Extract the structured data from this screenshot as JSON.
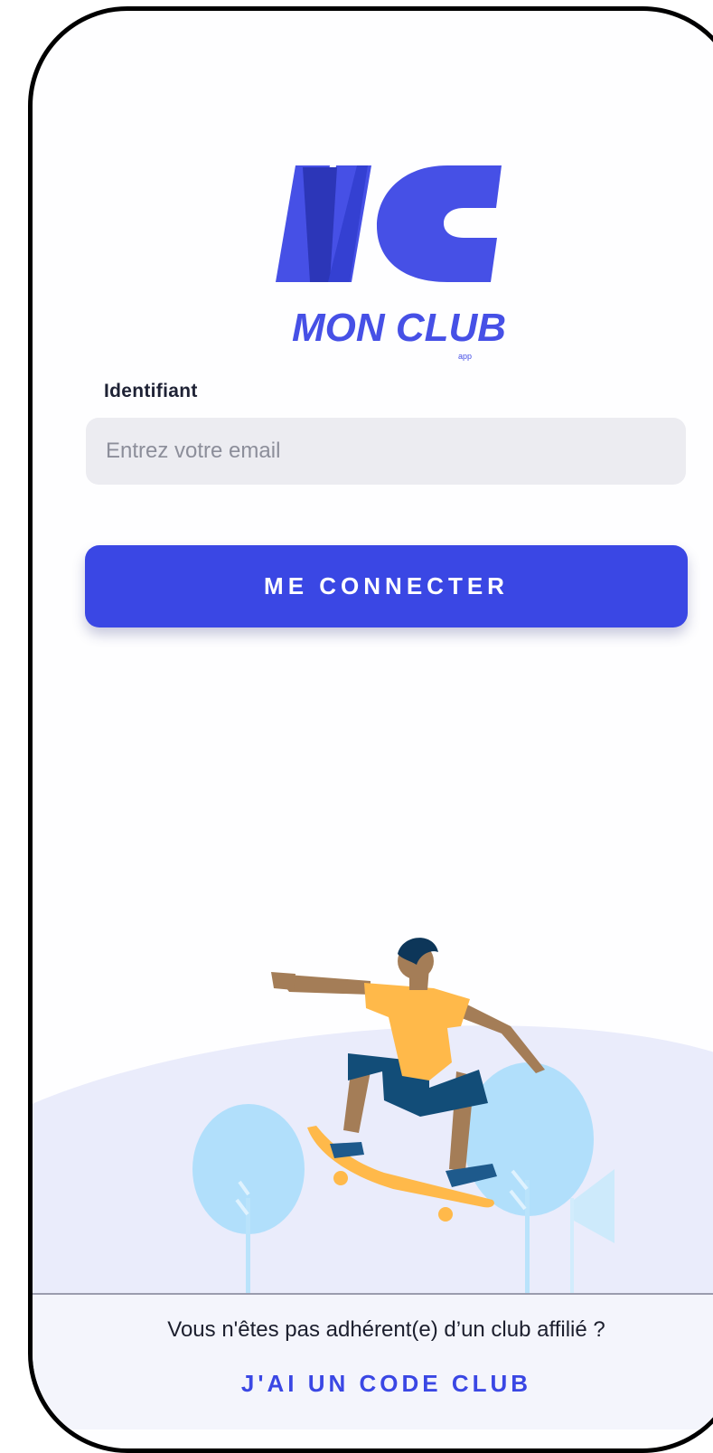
{
  "app": {
    "logo_text": "MON CLUB",
    "logo_subtext": "app",
    "brand_color": "#3a47e4",
    "logo_color": "#4650e6"
  },
  "login": {
    "id_label": "Identifiant",
    "email_placeholder": "Entrez votre email",
    "email_value": "",
    "connect_button": "ME CONNECTER"
  },
  "illustration": {
    "icon": "skateboarder-illustration"
  },
  "footer": {
    "question": "Vous n'êtes pas adhérent(e) d’un club affilié ?",
    "code_link": "J'AI UN CODE CLUB"
  }
}
